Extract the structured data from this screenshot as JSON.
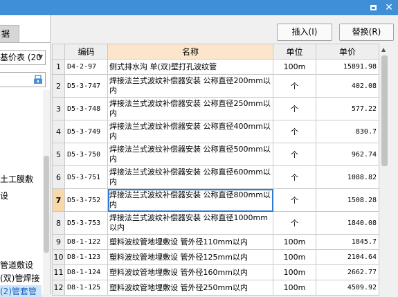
{
  "window": {
    "maximize_glyph": "",
    "close_glyph": "✕"
  },
  "left": {
    "tab_label": "据",
    "combo_value": "基价表 (20",
    "tree_items": [
      "土工膜敷",
      "设",
      "管道敷设",
      "(双)管焊接",
      "(2)管套管"
    ]
  },
  "toolbar": {
    "insert_label": "插入(I)",
    "replace_label": "替换(R)"
  },
  "table": {
    "headers": {
      "code": "编码",
      "name": "名称",
      "unit": "单位",
      "price": "单价"
    },
    "rows": [
      {
        "no": "1",
        "code": "D4-2-97",
        "name": "侧式排水沟 单(双)壁打孔波纹管",
        "unit": "100m",
        "price": "15891.98"
      },
      {
        "no": "2",
        "code": "D5-3-747",
        "name": "焊接法兰式波纹补偿器安装 公称直径200mm以内",
        "unit": "个",
        "price": "402.08"
      },
      {
        "no": "3",
        "code": "D5-3-748",
        "name": "焊接法兰式波纹补偿器安装 公称直径250mm以内",
        "unit": "个",
        "price": "577.22"
      },
      {
        "no": "4",
        "code": "D5-3-749",
        "name": "焊接法兰式波纹补偿器安装 公称直径400mm以内",
        "unit": "个",
        "price": "830.7"
      },
      {
        "no": "5",
        "code": "D5-3-750",
        "name": "焊接法兰式波纹补偿器安装 公称直径500mm以内",
        "unit": "个",
        "price": "962.74"
      },
      {
        "no": "6",
        "code": "D5-3-751",
        "name": "焊接法兰式波纹补偿器安装 公称直径600mm以内",
        "unit": "个",
        "price": "1088.82"
      },
      {
        "no": "7",
        "code": "D5-3-752",
        "name": "焊接法兰式波纹补偿器安装 公称直径800mm以内",
        "unit": "个",
        "price": "1508.28"
      },
      {
        "no": "8",
        "code": "D5-3-753",
        "name": "焊接法兰式波纹补偿器安装 公称直径1000mm以内",
        "unit": "个",
        "price": "1840.08"
      },
      {
        "no": "9",
        "code": "D8-1-122",
        "name": "塑料波纹管地埋敷设 管外径110mm以内",
        "unit": "100m",
        "price": "1845.7"
      },
      {
        "no": "10",
        "code": "D8-1-123",
        "name": "塑料波纹管地埋敷设 管外径125mm以内",
        "unit": "100m",
        "price": "2104.64"
      },
      {
        "no": "11",
        "code": "D8-1-124",
        "name": "塑料波纹管地埋敷设 管外径160mm以内",
        "unit": "100m",
        "price": "2662.77"
      },
      {
        "no": "12",
        "code": "D8-1-125",
        "name": "塑料波纹管地埋敷设 管外径250mm以内",
        "unit": "100m",
        "price": "4509.92"
      }
    ]
  }
}
